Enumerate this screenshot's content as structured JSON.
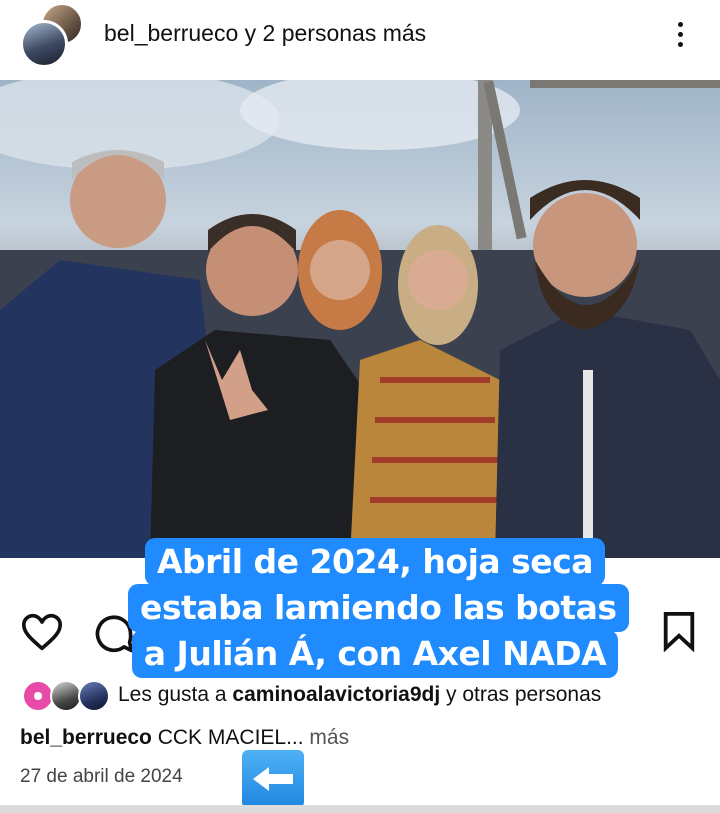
{
  "header": {
    "username": "bel_berrueco",
    "collab_text": " y 2 personas más"
  },
  "post": {
    "overlay_caption": {
      "line1": "Abril de 2024, hoja seca",
      "line2": "estaba lamiendo las botas",
      "line3": "a Julián Á, con Axel NADA"
    }
  },
  "likes": {
    "prefix": "Les gusta a ",
    "user": "caminoalavictoria9dj",
    "suffix": " y otras personas"
  },
  "caption": {
    "username": "bel_berrueco",
    "text": " CCK MACIEL...",
    "more": " más"
  },
  "date": "27 de abril de 2024",
  "icons": {
    "more": "more-vertical-icon",
    "like": "heart-icon",
    "comment": "comment-icon",
    "save": "bookmark-icon",
    "arrow": "left-arrow-emoji-icon"
  },
  "colors": {
    "caption_bg": "#1f8bff",
    "text": "#111111"
  }
}
